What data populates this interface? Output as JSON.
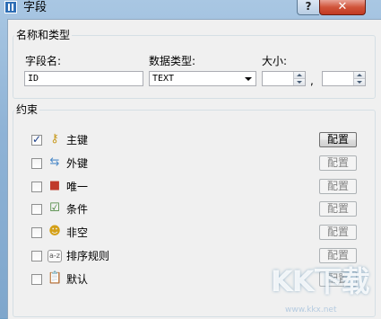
{
  "window": {
    "title": "字段",
    "help_glyph": "?",
    "close_glyph": "✕"
  },
  "name_group": {
    "legend": "名称和类型",
    "field_name_label": "字段名:",
    "field_name_value": "ID",
    "data_type_label": "数据类型:",
    "data_type_value": "TEXT",
    "size_label": "大小:",
    "size_value_1": "",
    "size_value_2": "",
    "separator": ","
  },
  "constraint_group": {
    "legend": "约束",
    "items": [
      {
        "label": "主键",
        "checked": true,
        "icon": "key-icon",
        "glyph": "⚷",
        "color": "#c89a1e",
        "button_label": "配置",
        "button_enabled": true
      },
      {
        "label": "外键",
        "checked": false,
        "icon": "foreign-key-icon",
        "glyph": "⇆",
        "color": "#4d8ac9",
        "button_label": "配置",
        "button_enabled": false
      },
      {
        "label": "唯一",
        "checked": false,
        "icon": "unique-icon",
        "glyph": "■",
        "color": "#c0392b",
        "button_label": "配置",
        "button_enabled": false
      },
      {
        "label": "条件",
        "checked": false,
        "icon": "condition-icon",
        "glyph": "☑",
        "color": "#3a7d2c",
        "button_label": "配置",
        "button_enabled": false
      },
      {
        "label": "非空",
        "checked": false,
        "icon": "not-null-icon",
        "glyph": "☻",
        "color": "#d4a017",
        "button_label": "配置",
        "button_enabled": false
      },
      {
        "label": "排序规则",
        "checked": false,
        "icon": "collation-icon",
        "glyph": "a-z",
        "color": "#555555",
        "button_label": "配置",
        "button_enabled": false
      },
      {
        "label": "默认",
        "checked": false,
        "icon": "default-icon",
        "glyph": "📋",
        "color": "#8a6d3b",
        "button_label": "配置",
        "button_enabled": false
      }
    ]
  },
  "watermark": {
    "logo": "KK下载",
    "url": "www.kkx.net"
  }
}
